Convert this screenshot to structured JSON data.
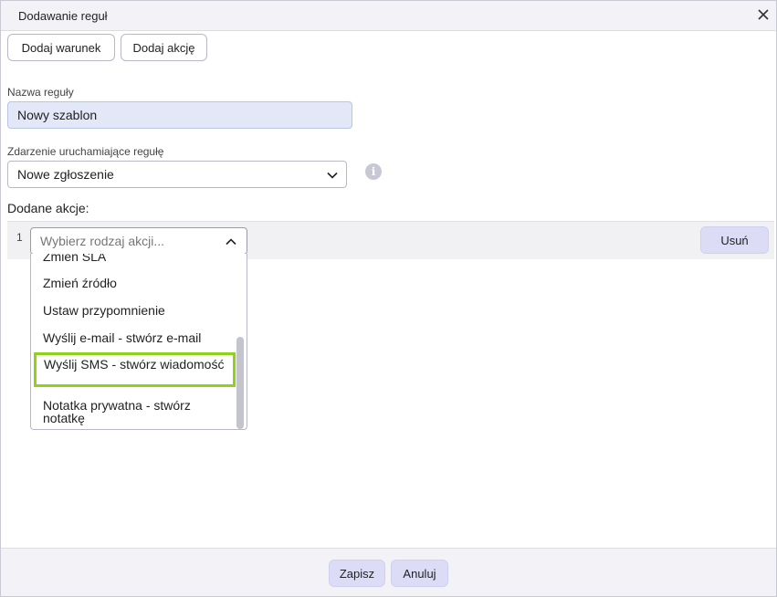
{
  "dialog": {
    "title": "Dodawanie reguł"
  },
  "toolbar": {
    "add_condition_label": "Dodaj warunek",
    "add_action_label": "Dodaj akcję"
  },
  "rule_name": {
    "label": "Nazwa reguły",
    "value": "Nowy szablon"
  },
  "trigger": {
    "label": "Zdarzenie uruchamiające regułę",
    "value": "Nowe zgłoszenie",
    "info_icon": "info-icon"
  },
  "actions": {
    "label": "Dodane akcje:",
    "rows": [
      {
        "number": "1",
        "placeholder": "Wybierz rodzaj akcji...",
        "remove_label": "Usuń"
      }
    ]
  },
  "dropdown": {
    "options": [
      "Zmień SLA",
      "Zmień źródło",
      "Ustaw przypomnienie",
      "Wyślij e-mail - stwórz e-mail",
      "Wyślij SMS - stwórz wiadomość",
      "Notatka prywatna - stwórz notatkę"
    ],
    "highlighted_option": "Wyślij SMS - stwórz wiadomość"
  },
  "footer": {
    "save_label": "Zapisz",
    "cancel_label": "Anuluj"
  },
  "colors": {
    "highlight_border": "#8ed21a",
    "primary_button": "#dcdcf6",
    "input_bg": "#e3e8f8"
  }
}
